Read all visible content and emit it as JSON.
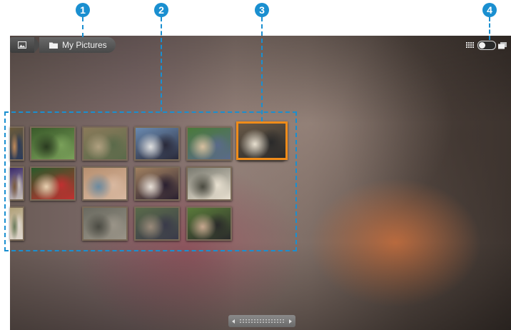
{
  "breadcrumb": {
    "home_icon": "pictures-icon",
    "folder_icon": "folder-icon",
    "current_label": "My Pictures"
  },
  "view_toggle": {
    "left_icon": "grid-view-icon",
    "right_icon": "stack-view-icon",
    "state": "grid"
  },
  "callouts": [
    "1",
    "2",
    "3",
    "4"
  ],
  "gallery": {
    "rows": 3,
    "selected_index": 5,
    "thumbnails": [
      {
        "name": "photo-1",
        "colors": [
          "#6a5a3a",
          "#2a3a5a",
          "#c08a5a"
        ]
      },
      {
        "name": "photo-2",
        "colors": [
          "#3a2a6a",
          "#c8c0b8",
          "#7a5a3a"
        ]
      },
      {
        "name": "photo-3",
        "colors": [
          "#b0a078",
          "#e0d8d0",
          "#6a7a5a"
        ]
      },
      {
        "name": "photo-4",
        "colors": [
          "#3a5a2a",
          "#7aa05a",
          "#2a3a20"
        ]
      },
      {
        "name": "photo-5",
        "colors": [
          "#2a5a2a",
          "#c03030",
          "#e8d0b0"
        ]
      },
      {
        "name": "photo-6",
        "colors": [
          "#6a5a48",
          "#2a2a2a",
          "#e8e0d0"
        ]
      },
      {
        "name": "photo-7",
        "colors": [
          "#8a7a5a",
          "#5a6a4a",
          "#b0a080"
        ]
      },
      {
        "name": "photo-8",
        "colors": [
          "#b89070",
          "#d8b8a0",
          "#6a8aa0"
        ]
      },
      {
        "name": "photo-9",
        "colors": [
          "#6a6a60",
          "#9a9488",
          "#4a4a42"
        ]
      },
      {
        "name": "photo-10",
        "colors": [
          "#6a8ab0",
          "#2a2a3a",
          "#e0e0e0"
        ]
      },
      {
        "name": "photo-11",
        "colors": [
          "#a08060",
          "#2a2030",
          "#e8e0d8"
        ]
      },
      {
        "name": "photo-12",
        "colors": [
          "#5a6a4a",
          "#3a3a4a",
          "#9a8a7a"
        ]
      },
      {
        "name": "photo-13",
        "colors": [
          "#4a7a3a",
          "#5a6a8a",
          "#d8c0a0"
        ]
      },
      {
        "name": "photo-14",
        "colors": [
          "#7a7a70",
          "#e8e0d0",
          "#4a4a40"
        ]
      },
      {
        "name": "photo-15",
        "colors": [
          "#5a7a3a",
          "#2a2a2a",
          "#c8a890"
        ]
      },
      {
        "name": "photo-16",
        "colors": [
          "#6a6050",
          "#2a2620",
          "#d0c8b8"
        ]
      }
    ]
  },
  "scroller": {
    "left_icon": "scroll-left-icon",
    "right_icon": "scroll-right-icon"
  },
  "colors": {
    "callout": "#1a8fd0",
    "selection": "#f08c1a"
  }
}
